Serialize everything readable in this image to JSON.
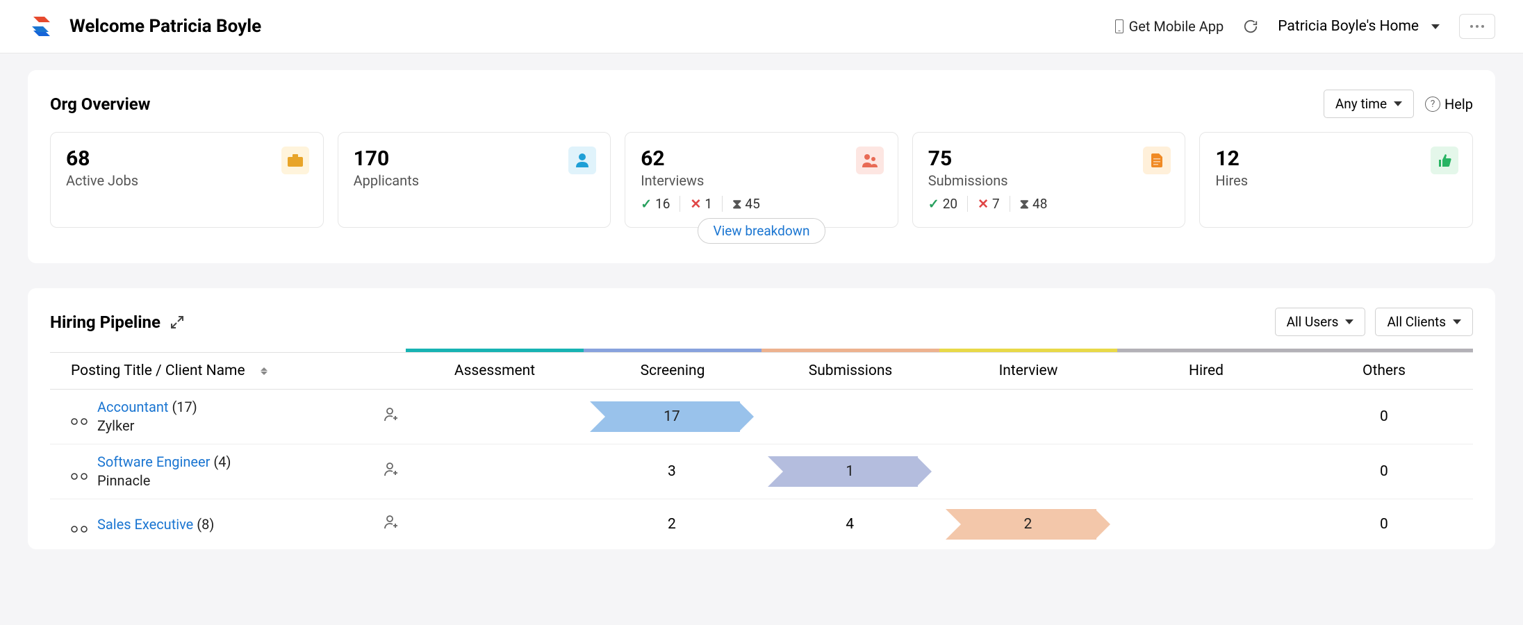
{
  "header": {
    "welcome": "Welcome Patricia Boyle",
    "mobile_app": "Get Mobile App",
    "home_dropdown": "Patricia Boyle's Home"
  },
  "overview": {
    "title": "Org Overview",
    "time_filter": "Any time",
    "help": "Help",
    "breakdown_label": "View breakdown",
    "stats": {
      "jobs": {
        "value": "68",
        "label": "Active Jobs"
      },
      "applicants": {
        "value": "170",
        "label": "Applicants"
      },
      "interviews": {
        "value": "62",
        "label": "Interviews",
        "approved": "16",
        "rejected": "1",
        "pending": "45"
      },
      "submissions": {
        "value": "75",
        "label": "Submissions",
        "approved": "20",
        "rejected": "7",
        "pending": "48"
      },
      "hires": {
        "value": "12",
        "label": "Hires"
      }
    }
  },
  "pipeline": {
    "title": "Hiring Pipeline",
    "users_filter": "All Users",
    "clients_filter": "All Clients",
    "columns": {
      "posting": "Posting Title / Client Name",
      "assessment": "Assessment",
      "screening": "Screening",
      "submissions": "Submissions",
      "interview": "Interview",
      "hired": "Hired",
      "others": "Others"
    },
    "rows": [
      {
        "title": "Accountant",
        "count": "(17)",
        "client": "Zylker",
        "assessment": "",
        "screening": "17",
        "screening_chip": true,
        "submissions": "",
        "interview": "",
        "hired": "",
        "others": "0"
      },
      {
        "title": "Software Engineer",
        "count": "(4)",
        "client": "Pinnacle",
        "assessment": "",
        "screening": "3",
        "submissions": "1",
        "submissions_chip": true,
        "interview": "",
        "hired": "",
        "others": "0"
      },
      {
        "title": "Sales Executive",
        "count": "(8)",
        "client": "",
        "assessment": "",
        "screening": "2",
        "submissions": "4",
        "interview": "2",
        "interview_chip": true,
        "hired": "",
        "others": "0"
      }
    ]
  }
}
